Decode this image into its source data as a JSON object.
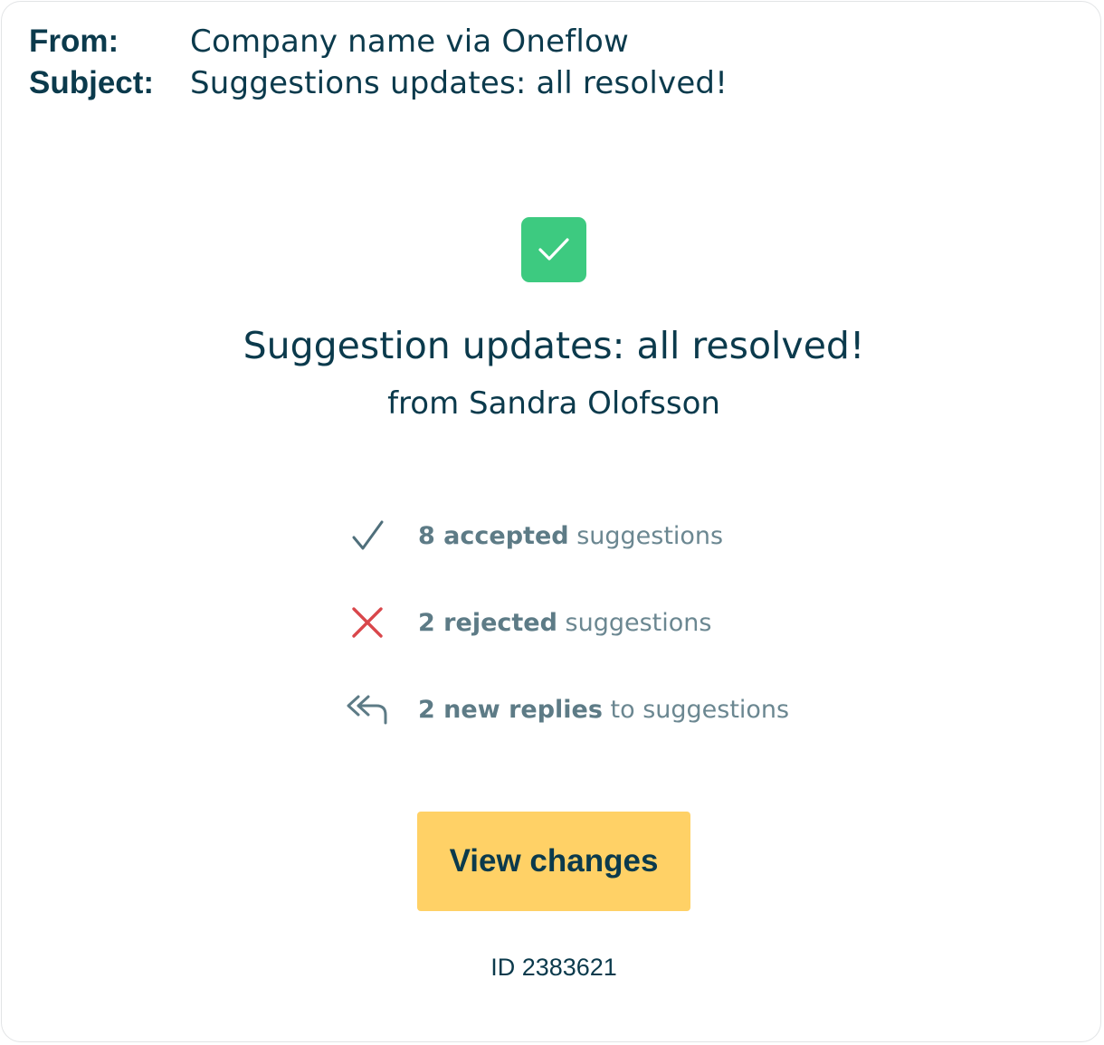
{
  "email_header": {
    "from_label": "From:",
    "from_value": "Company name via Oneflow",
    "subject_label": "Subject:",
    "subject_value": "Suggestions updates: all resolved!"
  },
  "hero": {
    "icon": "check-icon",
    "icon_color": "#3dca80",
    "title": "Suggestion updates: all resolved!",
    "subtitle": "from Sandra Olofsson"
  },
  "summary": {
    "items": [
      {
        "icon": "checkmark-icon",
        "strong": "8 accepted",
        "rest": " suggestions"
      },
      {
        "icon": "cross-icon",
        "strong": "2 rejected",
        "rest": " suggestions"
      },
      {
        "icon": "reply-all-icon",
        "strong": "2 new replies",
        "rest": " to suggestions"
      }
    ]
  },
  "cta": {
    "label": "View changes",
    "color": "#ffd166"
  },
  "footer": {
    "id_text": "ID 2383621"
  },
  "colors": {
    "text_primary": "#0b3a4c",
    "text_muted": "#6b8791",
    "reject": "#d9474b"
  }
}
